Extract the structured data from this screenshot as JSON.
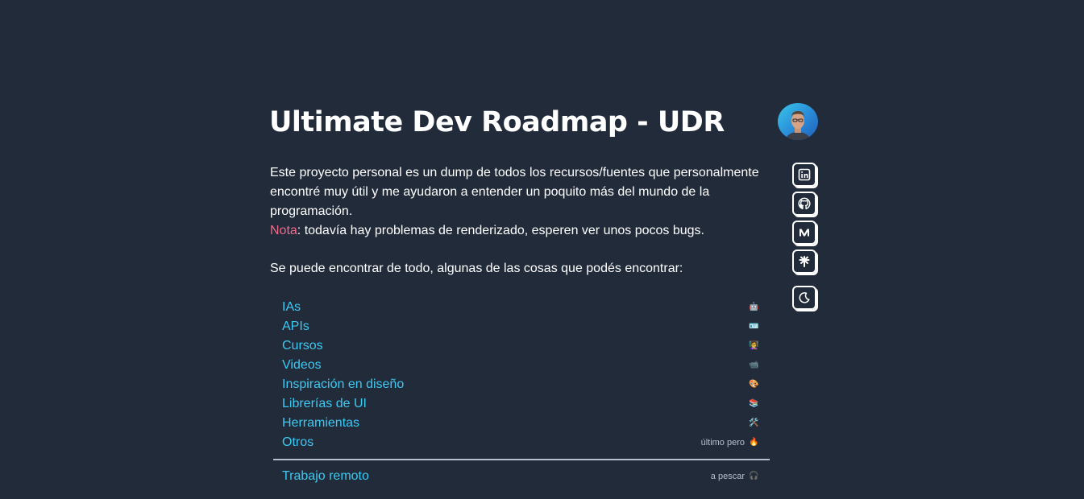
{
  "header": {
    "title": "Ultimate Dev Roadmap - UDR"
  },
  "intro": {
    "paragraph": "Este proyecto personal es un dump de todos los recursos/fuentes que personalmente encontré muy útil y me ayudaron a entender un poquito más del mundo de la programación.",
    "note_label": "Nota",
    "note_text": ": todavía hay problemas de renderizado, esperen ver unos pocos bugs.",
    "subheading": "Se puede encontrar de todo, algunas de las cosas que podés encontrar:"
  },
  "social": [
    {
      "name": "linkedin-icon"
    },
    {
      "name": "github-icon"
    },
    {
      "name": "medium-icon"
    },
    {
      "name": "linktree-icon"
    },
    {
      "name": "moon-icon"
    }
  ],
  "categories": [
    {
      "label": "IAs",
      "note": "",
      "emoji": "🤖"
    },
    {
      "label": "APIs",
      "note": "",
      "emoji": "🪪"
    },
    {
      "label": "Cursos",
      "note": "",
      "emoji": "👩‍🏫"
    },
    {
      "label": "Videos",
      "note": "",
      "emoji": "📹"
    },
    {
      "label": "Inspiración en diseño",
      "note": "",
      "emoji": "🎨"
    },
    {
      "label": "Librerías de UI",
      "note": "",
      "emoji": "📚"
    },
    {
      "label": "Herramientas",
      "note": "",
      "emoji": "🛠️"
    },
    {
      "label": "Otros",
      "note": "último pero",
      "emoji": "🔥"
    }
  ],
  "remote": {
    "label": "Trabajo remoto",
    "note": "a pescar",
    "emoji": "🎧"
  },
  "colors": {
    "background": "#222b3a",
    "link": "#3dc9f2",
    "note_accent": "#f06b8a",
    "muted": "#b7becc"
  }
}
